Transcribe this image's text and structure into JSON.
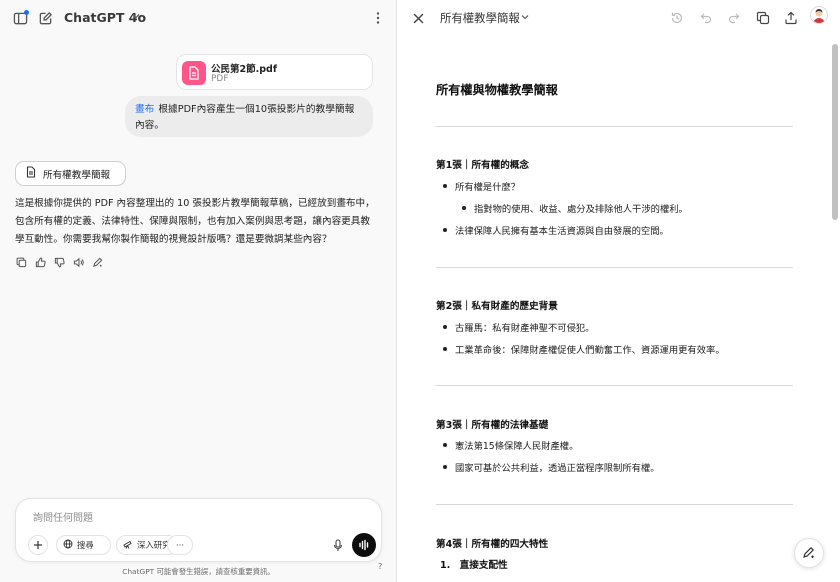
{
  "left_header": {
    "model_name": "ChatGPT 4o",
    "icons": [
      "sidebar-toggle-icon",
      "new-chat-icon",
      "chevron-down-icon",
      "more-vertical-icon"
    ]
  },
  "attachment": {
    "file_name": "公民第2節.pdf",
    "file_type": "PDF",
    "icon": "document-icon",
    "accent_color": "#ff5588"
  },
  "user_message": {
    "mention": "畫布",
    "text": "根據PDF內容產生一個10張投影片的教學簡報內容。"
  },
  "canvas_chip": {
    "label": "所有權教學簡報",
    "icon": "document-icon"
  },
  "assistant_message": {
    "text": "這是根據你提供的 PDF 內容整理出的 10 張投影片教學簡報草稿，已經放到畫布中，包含所有權的定義、法律特性、保障與限制，也有加入案例與思考題，讓內容更具教學互動性。你需要我幫你製作簡報的視覺設計版嗎？還是要微調某些內容？",
    "actions": [
      "copy-icon",
      "thumbs-up-icon",
      "thumbs-down-icon",
      "read-aloud-icon",
      "edit-model-icon"
    ]
  },
  "composer": {
    "placeholder": "詢問任何問題",
    "search_label": "搜尋",
    "research_label": "深入研究",
    "more_label": "···"
  },
  "footer": {
    "disclaimer": "ChatGPT 可能會發生錯誤，請查核重要資訊。",
    "help": "?"
  },
  "canvas": {
    "title": "所有權教學簡報",
    "toolbar_icons": [
      "history-icon",
      "undo-icon",
      "redo-icon",
      "copy-icon",
      "share-icon"
    ],
    "document": {
      "heading": "所有權與物權教學簡報",
      "slides": [
        {
          "title": "第1張｜所有權的概念",
          "bullets": [
            {
              "text": "所有權是什麼？",
              "level": 1
            },
            {
              "text": "指對物的使用、收益、處分及排除他人干涉的權利。",
              "level": 2
            },
            {
              "text": "法律保障人民擁有基本生活資源與自由發展的空間。",
              "level": 1
            }
          ]
        },
        {
          "title": "第2張｜私有財產的歷史背景",
          "bullets": [
            {
              "text": "古羅馬：私有財產神聖不可侵犯。",
              "level": 1
            },
            {
              "text": "工業革命後：保障財產權促使人們勤奮工作、資源運用更有效率。",
              "level": 1
            }
          ]
        },
        {
          "title": "第3張｜所有權的法律基礎",
          "bullets": [
            {
              "text": "憲法第15條保障人民財產權。",
              "level": 1
            },
            {
              "text": "國家可基於公共利益，透過正當程序限制所有權。",
              "level": 1
            }
          ]
        },
        {
          "title": "第4張｜所有權的四大特性",
          "numbered": [
            {
              "number": "1.",
              "text": "直接支配性"
            }
          ]
        }
      ]
    }
  }
}
